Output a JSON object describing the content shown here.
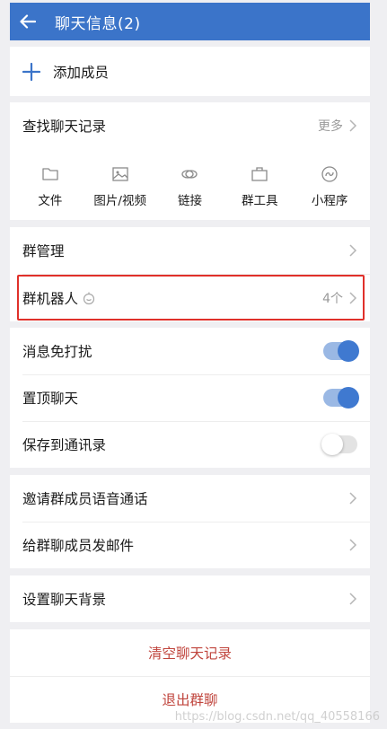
{
  "header": {
    "title": "聊天信息(2)"
  },
  "add_member": {
    "label": "添加成员"
  },
  "search_history": {
    "label": "查找聊天记录",
    "more": "更多"
  },
  "tools": [
    {
      "label": "文件",
      "icon": "folder-icon"
    },
    {
      "label": "图片/视频",
      "icon": "image-icon"
    },
    {
      "label": "链接",
      "icon": "link-icon"
    },
    {
      "label": "群工具",
      "icon": "toolbox-icon"
    },
    {
      "label": "小程序",
      "icon": "mini-program-icon"
    }
  ],
  "group_manage": {
    "label": "群管理"
  },
  "group_bot": {
    "label": "群机器人",
    "count": "4个"
  },
  "mute": {
    "label": "消息免打扰",
    "on": true
  },
  "pin": {
    "label": "置顶聊天",
    "on": true
  },
  "save_contacts": {
    "label": "保存到通讯录",
    "on": false
  },
  "invite_call": {
    "label": "邀请群成员语音通话"
  },
  "send_mail": {
    "label": "给群聊成员发邮件"
  },
  "background": {
    "label": "设置聊天背景"
  },
  "clear_history": {
    "label": "清空聊天记录"
  },
  "exit_group": {
    "label": "退出群聊"
  },
  "watermark": "https://blog.csdn.net/qq_40558166",
  "colors": {
    "header": "#3b74c9",
    "toggle_on": "#3f79d0",
    "danger": "#c0453d",
    "highlight": "#e0302a"
  }
}
